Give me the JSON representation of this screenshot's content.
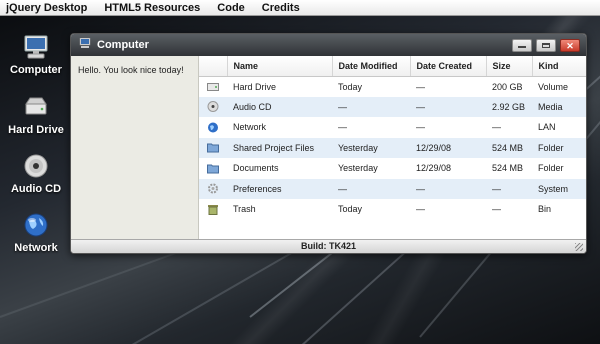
{
  "menubar": {
    "items": [
      {
        "label": "jQuery Desktop"
      },
      {
        "label": "HTML5 Resources"
      },
      {
        "label": "Code"
      },
      {
        "label": "Credits"
      }
    ]
  },
  "desktop": {
    "icons": [
      {
        "label": "Computer",
        "icon": "computer-icon"
      },
      {
        "label": "Hard Drive",
        "icon": "hard-drive-icon"
      },
      {
        "label": "Audio CD",
        "icon": "audio-cd-icon"
      },
      {
        "label": "Network",
        "icon": "network-icon"
      }
    ]
  },
  "window": {
    "title": "Computer",
    "icon": "computer-icon",
    "sidebar_text": "Hello. You look nice today!",
    "status": "Build: TK421",
    "columns": [
      "Name",
      "Date Modified",
      "Date Created",
      "Size",
      "Kind"
    ],
    "rows": [
      {
        "icon": "hard-drive-icon",
        "name": "Hard Drive",
        "modified": "Today",
        "created": "—",
        "size": "200 GB",
        "kind": "Volume"
      },
      {
        "icon": "audio-cd-icon",
        "name": "Audio CD",
        "modified": "—",
        "created": "—",
        "size": "2.92 GB",
        "kind": "Media"
      },
      {
        "icon": "network-icon",
        "name": "Network",
        "modified": "—",
        "created": "—",
        "size": "—",
        "kind": "LAN"
      },
      {
        "icon": "folder-icon",
        "name": "Shared Project Files",
        "modified": "Yesterday",
        "created": "12/29/08",
        "size": "524 MB",
        "kind": "Folder"
      },
      {
        "icon": "folder-icon",
        "name": "Documents",
        "modified": "Yesterday",
        "created": "12/29/08",
        "size": "524 MB",
        "kind": "Folder"
      },
      {
        "icon": "gear-icon",
        "name": "Preferences",
        "modified": "—",
        "created": "—",
        "size": "—",
        "kind": "System"
      },
      {
        "icon": "trash-icon",
        "name": "Trash",
        "modified": "Today",
        "created": "—",
        "size": "—",
        "kind": "Bin"
      }
    ]
  },
  "colors": {
    "titlebar": "#2f3236",
    "row_alt": "#e4eef8",
    "close_button": "#c83a2a"
  }
}
